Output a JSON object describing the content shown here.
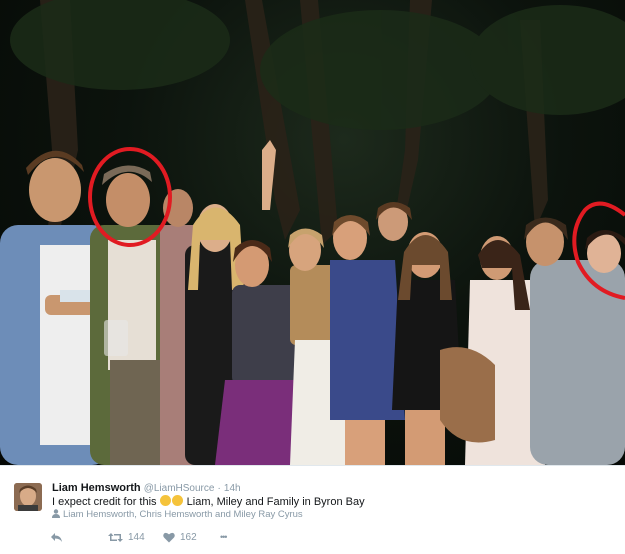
{
  "tweet": {
    "display_name": "Liam Hemsworth",
    "handle": "@LiamHSource",
    "separator": "·",
    "timestamp": "14h",
    "text_before_emoji": "I expect credit for this",
    "text_after_emoji": "Liam, Miley and Family in Byron Bay",
    "emojis": [
      "grimacing-face-emoji",
      "laughing-face-emoji"
    ],
    "tagged_people": "Liam Hemsworth, Chris Hemsworth and Miley Ray Cyrus",
    "retweet_count": "144",
    "like_count": "162",
    "more_label": "•••"
  },
  "photo": {
    "annotation_color": "#e11b22",
    "background_color": "#0c130d"
  },
  "icons": {
    "reply": "reply-icon",
    "retweet": "retweet-icon",
    "like": "heart-icon",
    "more": "more-icon",
    "tag": "person-icon"
  }
}
